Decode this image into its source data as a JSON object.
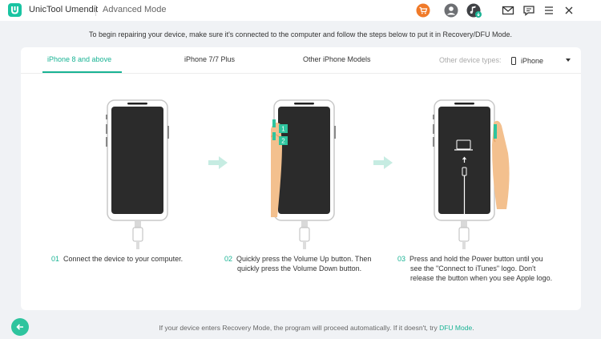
{
  "window": {
    "app_name": "UnicTool Umendit",
    "mode": "Advanced Mode"
  },
  "toolbar_icons": [
    "cart-icon",
    "user-icon",
    "music-update-icon",
    "mail-icon",
    "feedback-icon",
    "menu-icon",
    "close-icon"
  ],
  "instruction": "To begin repairing your device, make sure it's connected to the computer and follow the steps below to put it in Recovery/DFU Mode.",
  "tabs": [
    {
      "label": "iPhone 8 and above",
      "active": true
    },
    {
      "label": "iPhone 7/7 Plus",
      "active": false
    },
    {
      "label": "Other iPhone Models",
      "active": false
    }
  ],
  "device_type": {
    "label": "Other device types:",
    "selected": "iPhone"
  },
  "steps": [
    {
      "num": "01",
      "text": "Connect the device to your computer."
    },
    {
      "num": "02",
      "text": "Quickly press the Volume Up button. Then quickly press the Volume Down button.",
      "badges": [
        "1",
        "2"
      ]
    },
    {
      "num": "03",
      "text": "Press and hold the Power button until you see the \"Connect to iTunes\" logo. Don't release the button when you see Apple logo."
    }
  ],
  "footer": {
    "note": "If your device enters Recovery Mode, the program will proceed automatically. If it doesn't, try ",
    "link": "DFU Mode",
    "end": "."
  },
  "colors": {
    "accent": "#19b394",
    "cart": "#f07a29",
    "background": "#f0f2f5"
  }
}
